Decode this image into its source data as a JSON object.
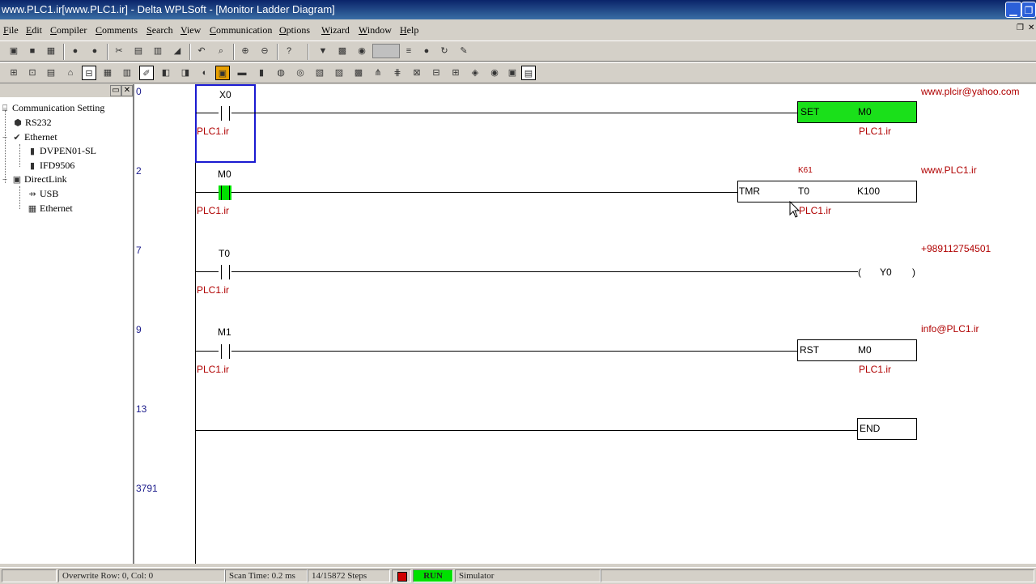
{
  "window": {
    "title": "www.PLC1.ir[www.PLC1.ir] - Delta WPLSoft - [Monitor Ladder Diagram]"
  },
  "menu": [
    "File",
    "Edit",
    "Compiler",
    "Comments",
    "Search",
    "View",
    "Communication",
    "Options",
    "Wizard",
    "Window",
    "Help"
  ],
  "tree": {
    "root": "Communication Setting",
    "rs232": "RS232",
    "ethernet": "Ethernet",
    "dvpen": "DVPEN01-SL",
    "ifd": "IFD9506",
    "directlink": "DirectLink",
    "usb": "USB",
    "ethernet2": "Ethernet"
  },
  "ladder": {
    "steps": [
      "0",
      "2",
      "7",
      "9",
      "13",
      "3791"
    ],
    "rung0": {
      "contact": "X0",
      "contact_comment": "PLC1.ir",
      "instr": "SET",
      "operand": "M0",
      "coil_comment": "PLC1.ir",
      "note": "www.plcir@yahoo.com"
    },
    "rung1": {
      "contact": "M0",
      "contact_comment": "PLC1.ir",
      "current": "K61",
      "instr": "TMR",
      "operand": "T0",
      "setpoint": "K100",
      "coil_comment": "PLC1.ir",
      "note": "www.PLC1.ir"
    },
    "rung2": {
      "contact": "T0",
      "contact_comment": "PLC1.ir",
      "coil_open": "(",
      "coil": "Y0",
      "coil_close": ")",
      "note": "+989112754501"
    },
    "rung3": {
      "contact": "M1",
      "contact_comment": "PLC1.ir",
      "instr": "RST",
      "operand": "M0",
      "coil_comment": "PLC1.ir",
      "note": "info@PLC1.ir"
    },
    "rung4": {
      "instr": "END"
    }
  },
  "status": {
    "overwrite": "Overwrite Row: 0, Col: 0",
    "scan": "Scan Time: 0.2 ms",
    "steps": "14/15872 Steps",
    "run": "RUN",
    "mode": "Simulator"
  },
  "colors": {
    "accent_green": "#1ae01a",
    "comment_red": "#b00000",
    "step_blue": "#1a1a8a"
  }
}
